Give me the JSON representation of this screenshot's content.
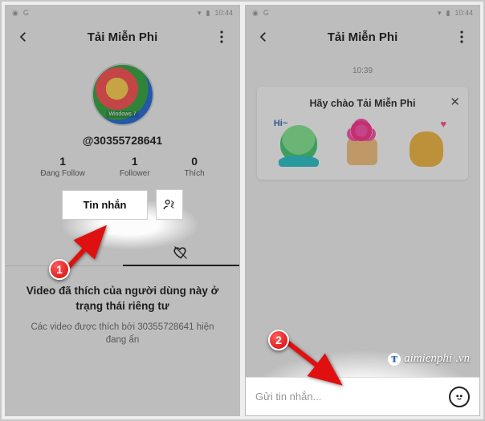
{
  "status": {
    "time": "10:44",
    "left_g": "G"
  },
  "left": {
    "header_title": "Tải Miễn Phi",
    "avatar_label": "Windows 7",
    "handle": "@30355728641",
    "stats": [
      {
        "num": "1",
        "lbl": "Đang Follow"
      },
      {
        "num": "1",
        "lbl": "Follower"
      },
      {
        "num": "0",
        "lbl": "Thích"
      }
    ],
    "message_btn": "Tin nhắn",
    "empty_title": "Video đã thích của người dùng này ở trạng thái riêng tư",
    "empty_sub": "Các video được thích bởi 30355728641 hiện đang ẩn"
  },
  "right": {
    "header_title": "Tải Miễn Phi",
    "chat_time": "10:39",
    "greet_title": "Hãy chào Tải Miễn Phi",
    "sticker_hi": "Hi~",
    "input_placeholder": "Gửi tin nhắn..."
  },
  "markers": {
    "m1": "1",
    "m2": "2"
  },
  "watermark": {
    "text": "aimienphi",
    "suffix": ".vn",
    "badge": "T"
  }
}
